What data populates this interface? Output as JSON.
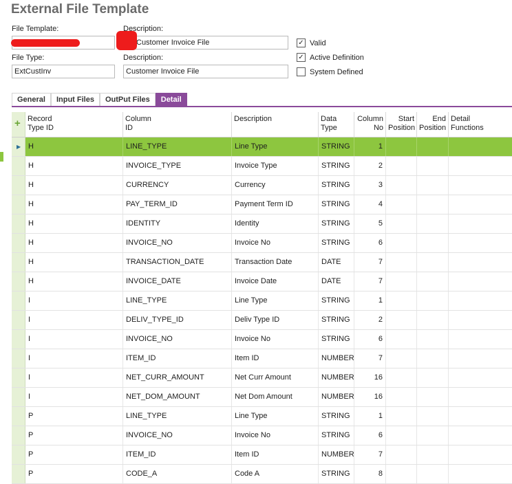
{
  "page_title": "External File Template",
  "form": {
    "file_template_label": "File Template:",
    "file_template_value": "",
    "description1_label": "Description:",
    "description1_value": "Customer Invoice File",
    "file_type_label": "File Type:",
    "file_type_value": "ExtCustInv",
    "description2_label": "Description:",
    "description2_value": "Customer Invoice File"
  },
  "checkboxes": [
    {
      "label": "Valid",
      "checked": true
    },
    {
      "label": "Active Definition",
      "checked": true
    },
    {
      "label": "System Defined",
      "checked": false
    }
  ],
  "tabs": [
    {
      "label": "General",
      "active": false
    },
    {
      "label": "Input Files",
      "active": false
    },
    {
      "label": "OutPut Files",
      "active": false
    },
    {
      "label": "Detail",
      "active": true
    }
  ],
  "grid": {
    "headers": {
      "record": "Record\nType ID",
      "column": "Column\nID",
      "description": "Description",
      "data_type": "Data\nType",
      "column_no": "Column\nNo",
      "start_position": "Start\nPosition",
      "end_position": "End\nPosition",
      "detail_functions": "Detail\nFunctions"
    },
    "rows": [
      {
        "record": "H",
        "column": "LINE_TYPE",
        "description": "Line Type",
        "data_type": "STRING",
        "column_no": "1",
        "selected": true
      },
      {
        "record": "H",
        "column": "INVOICE_TYPE",
        "description": "Invoice Type",
        "data_type": "STRING",
        "column_no": "2"
      },
      {
        "record": "H",
        "column": "CURRENCY",
        "description": "Currency",
        "data_type": "STRING",
        "column_no": "3"
      },
      {
        "record": "H",
        "column": "PAY_TERM_ID",
        "description": "Payment Term ID",
        "data_type": "STRING",
        "column_no": "4"
      },
      {
        "record": "H",
        "column": "IDENTITY",
        "description": "Identity",
        "data_type": "STRING",
        "column_no": "5"
      },
      {
        "record": "H",
        "column": "INVOICE_NO",
        "description": "Invoice No",
        "data_type": "STRING",
        "column_no": "6"
      },
      {
        "record": "H",
        "column": "TRANSACTION_DATE",
        "description": "Transaction Date",
        "data_type": "DATE",
        "column_no": "7"
      },
      {
        "record": "H",
        "column": "INVOICE_DATE",
        "description": "Invoice Date",
        "data_type": "DATE",
        "column_no": "7"
      },
      {
        "record": "I",
        "column": "LINE_TYPE",
        "description": "Line Type",
        "data_type": "STRING",
        "column_no": "1"
      },
      {
        "record": "I",
        "column": "DELIV_TYPE_ID",
        "description": "Deliv Type ID",
        "data_type": "STRING",
        "column_no": "2"
      },
      {
        "record": "I",
        "column": "INVOICE_NO",
        "description": "Invoice No",
        "data_type": "STRING",
        "column_no": "6"
      },
      {
        "record": "I",
        "column": "ITEM_ID",
        "description": "Item ID",
        "data_type": "NUMBER",
        "column_no": "7"
      },
      {
        "record": "I",
        "column": "NET_CURR_AMOUNT",
        "description": "Net Curr Amount",
        "data_type": "NUMBER",
        "column_no": "16"
      },
      {
        "record": "I",
        "column": "NET_DOM_AMOUNT",
        "description": "Net Dom Amount",
        "data_type": "NUMBER",
        "column_no": "16"
      },
      {
        "record": "P",
        "column": "LINE_TYPE",
        "description": "Line Type",
        "data_type": "STRING",
        "column_no": "1"
      },
      {
        "record": "P",
        "column": "INVOICE_NO",
        "description": "Invoice No",
        "data_type": "STRING",
        "column_no": "6"
      },
      {
        "record": "P",
        "column": "ITEM_ID",
        "description": "Item ID",
        "data_type": "NUMBER",
        "column_no": "7"
      },
      {
        "record": "P",
        "column": "CODE_A",
        "description": "Code A",
        "data_type": "STRING",
        "column_no": "8"
      }
    ]
  },
  "colors": {
    "accent_green": "#8dc63f",
    "tab_purple": "#8a4a9a",
    "redaction_red": "#ee1c1c"
  }
}
